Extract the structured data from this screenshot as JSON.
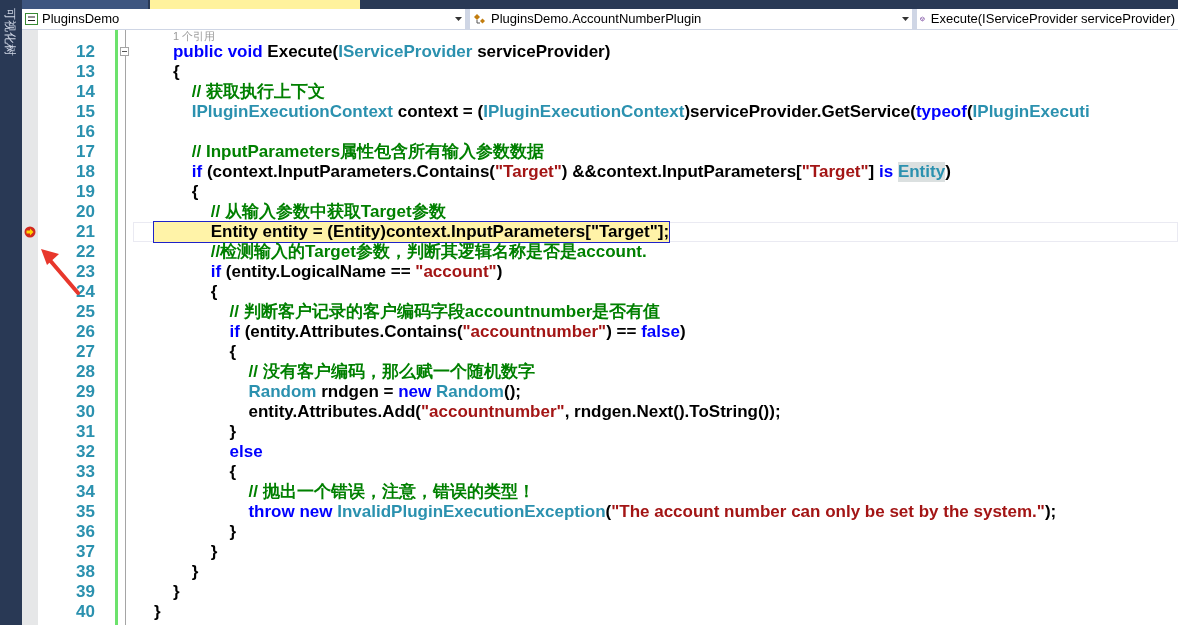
{
  "side_panel": {
    "title": "可视化树"
  },
  "tabs": [
    {
      "selected": false
    },
    {
      "selected": true
    }
  ],
  "navigation_bar": {
    "project": "PluginsDemo",
    "class": "PluginsDemo.AccountNumberPlugin",
    "member": "Execute(IServiceProvider serviceProvider)"
  },
  "code_lens": "1 个引用",
  "lines": [
    {
      "number": "12",
      "expanded": true,
      "tokens": [
        {
          "kind": "keyword",
          "text": "    public void"
        },
        {
          "kind": "plain",
          "text": " Execute("
        },
        {
          "kind": "type",
          "text": "IServiceProvider"
        },
        {
          "kind": "plain",
          "text": " serviceProvider)"
        }
      ]
    },
    {
      "number": "13",
      "tokens": [
        {
          "kind": "plain",
          "text": "    {"
        }
      ]
    },
    {
      "number": "14",
      "tokens": [
        {
          "kind": "comment",
          "text": "        // 获取执行上下文"
        }
      ]
    },
    {
      "number": "15",
      "tokens": [
        {
          "kind": "type",
          "text": "        IPluginExecutionContext"
        },
        {
          "kind": "plain",
          "text": " context = ("
        },
        {
          "kind": "type",
          "text": "IPluginExecutionContext"
        },
        {
          "kind": "plain",
          "text": ")serviceProvider.GetService("
        },
        {
          "kind": "keyword",
          "text": "typeof"
        },
        {
          "kind": "plain",
          "text": "("
        },
        {
          "kind": "type",
          "text": "IPluginExecuti"
        }
      ]
    },
    {
      "number": "16"
    },
    {
      "number": "17",
      "tokens": [
        {
          "kind": "comment",
          "text": "        // InputParameters属性包含所有输入参数数据"
        }
      ]
    },
    {
      "number": "18",
      "tokens": [
        {
          "kind": "keyword",
          "text": "        if"
        },
        {
          "kind": "plain",
          "text": " (context.InputParameters.Contains("
        },
        {
          "kind": "string",
          "text": "\"Target\""
        },
        {
          "kind": "plain",
          "text": ") &&context.InputParameters["
        },
        {
          "kind": "string",
          "text": "\"Target\""
        },
        {
          "kind": "plain",
          "text": "] "
        },
        {
          "kind": "keyword",
          "text": "is "
        },
        {
          "kind": "type",
          "text": "Entity",
          "highlighted": true
        },
        {
          "kind": "plain",
          "text": ")"
        }
      ]
    },
    {
      "number": "19",
      "tokens": [
        {
          "kind": "plain",
          "text": "        {"
        }
      ]
    },
    {
      "number": "20",
      "tokens": [
        {
          "kind": "comment",
          "text": "            // 从输入参数中获取Target参数"
        }
      ]
    },
    {
      "number": "21",
      "current": true,
      "tokens": [
        {
          "kind": "plain",
          "text": "            Entity entity = (Entity)context.InputParameters["
        },
        {
          "kind": "plain",
          "text": "\"Target\""
        },
        {
          "kind": "plain",
          "text": "];"
        }
      ]
    },
    {
      "number": "22",
      "tokens": [
        {
          "kind": "comment",
          "text": "            //检测输入的Target参数，判断其逻辑名称是否是account."
        }
      ]
    },
    {
      "number": "23",
      "tokens": [
        {
          "kind": "keyword",
          "text": "            if"
        },
        {
          "kind": "plain",
          "text": " (entity.LogicalName == "
        },
        {
          "kind": "string",
          "text": "\"account\""
        },
        {
          "kind": "plain",
          "text": ")"
        }
      ]
    },
    {
      "number": "24",
      "tokens": [
        {
          "kind": "plain",
          "text": "            {"
        }
      ]
    },
    {
      "number": "25",
      "tokens": [
        {
          "kind": "comment",
          "text": "                // 判断客户记录的客户编码字段accountnumber是否有值"
        }
      ]
    },
    {
      "number": "26",
      "tokens": [
        {
          "kind": "keyword",
          "text": "                if"
        },
        {
          "kind": "plain",
          "text": " (entity.Attributes.Contains("
        },
        {
          "kind": "string",
          "text": "\"accountnumber\""
        },
        {
          "kind": "plain",
          "text": ") == "
        },
        {
          "kind": "keyword",
          "text": "false"
        },
        {
          "kind": "plain",
          "text": ")"
        }
      ]
    },
    {
      "number": "27",
      "tokens": [
        {
          "kind": "plain",
          "text": "                {"
        }
      ]
    },
    {
      "number": "28",
      "tokens": [
        {
          "kind": "comment",
          "text": "                    // 没有客户编码，那么赋一个随机数字"
        }
      ]
    },
    {
      "number": "29",
      "tokens": [
        {
          "kind": "type",
          "text": "                    Random"
        },
        {
          "kind": "plain",
          "text": " rndgen = "
        },
        {
          "kind": "keyword",
          "text": "new "
        },
        {
          "kind": "type",
          "text": "Random"
        },
        {
          "kind": "plain",
          "text": "();"
        }
      ]
    },
    {
      "number": "30",
      "tokens": [
        {
          "kind": "plain",
          "text": "                    entity.Attributes.Add("
        },
        {
          "kind": "string",
          "text": "\"accountnumber\""
        },
        {
          "kind": "plain",
          "text": ", rndgen.Next().ToString());"
        }
      ]
    },
    {
      "number": "31",
      "tokens": [
        {
          "kind": "plain",
          "text": "                }"
        }
      ]
    },
    {
      "number": "32",
      "tokens": [
        {
          "kind": "keyword",
          "text": "                else"
        }
      ]
    },
    {
      "number": "33",
      "tokens": [
        {
          "kind": "plain",
          "text": "                {"
        }
      ]
    },
    {
      "number": "34",
      "tokens": [
        {
          "kind": "comment",
          "text": "                    // 抛出一个错误，注意，错误的类型！"
        }
      ]
    },
    {
      "number": "35",
      "tokens": [
        {
          "kind": "keyword",
          "text": "                    throw new "
        },
        {
          "kind": "type",
          "text": "InvalidPluginExecutionException"
        },
        {
          "kind": "plain",
          "text": "("
        },
        {
          "kind": "string",
          "text": "\"The account number can only be set by the system.\""
        },
        {
          "kind": "plain",
          "text": ");"
        }
      ]
    },
    {
      "number": "36",
      "tokens": [
        {
          "kind": "plain",
          "text": "                }"
        }
      ]
    },
    {
      "number": "37",
      "tokens": [
        {
          "kind": "plain",
          "text": "            }"
        }
      ]
    },
    {
      "number": "38",
      "tokens": [
        {
          "kind": "plain",
          "text": "        }"
        }
      ]
    },
    {
      "number": "39",
      "tokens": [
        {
          "kind": "plain",
          "text": "    }"
        }
      ]
    },
    {
      "number": "40",
      "tokens": [
        {
          "kind": "plain",
          "text": "}"
        }
      ]
    }
  ]
}
